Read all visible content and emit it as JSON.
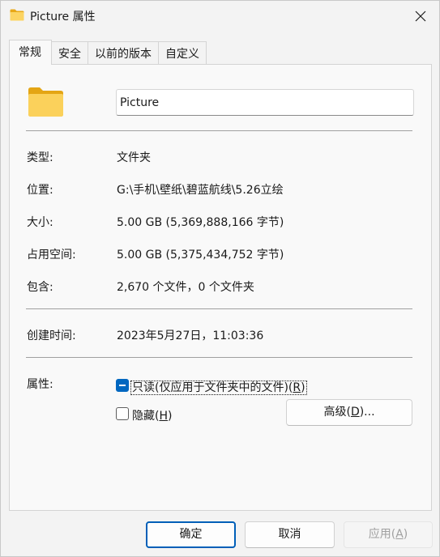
{
  "window": {
    "title": "Picture 属性",
    "icon": "folder-icon",
    "close_icon": "close-icon"
  },
  "tabs": [
    {
      "label": "常规",
      "active": true
    },
    {
      "label": "安全",
      "active": false
    },
    {
      "label": "以前的版本",
      "active": false
    },
    {
      "label": "自定义",
      "active": false
    }
  ],
  "general": {
    "name": "Picture",
    "type_label": "类型:",
    "type_value": "文件夹",
    "location_label": "位置:",
    "location_value": "G:\\手机\\壁纸\\碧蓝航线\\5.26立绘",
    "size_label": "大小:",
    "size_value": "5.00 GB (5,369,888,166 字节)",
    "disk_size_label": "占用空间:",
    "disk_size_value": "5.00 GB (5,375,434,752 字节)",
    "contains_label": "包含:",
    "contains_value": "2,670 个文件，0 个文件夹",
    "created_label": "创建时间:",
    "created_value": "2023年5月27日，11:03:36",
    "attributes_label": "属性:",
    "readonly_label": "只读(仅应用于文件夹中的文件)(",
    "readonly_key": "R",
    "readonly_suffix": ")",
    "readonly_state": "indeterminate",
    "hidden_label": "隐藏(",
    "hidden_key": "H",
    "hidden_suffix": ")",
    "hidden_checked": false,
    "advanced_label": "高级(",
    "advanced_key": "D",
    "advanced_suffix": ")..."
  },
  "buttons": {
    "ok": "确定",
    "cancel": "取消",
    "apply_label": "应用(",
    "apply_key": "A",
    "apply_suffix": ")"
  },
  "colors": {
    "accent": "#0067c0",
    "folder": "#f5c542"
  }
}
